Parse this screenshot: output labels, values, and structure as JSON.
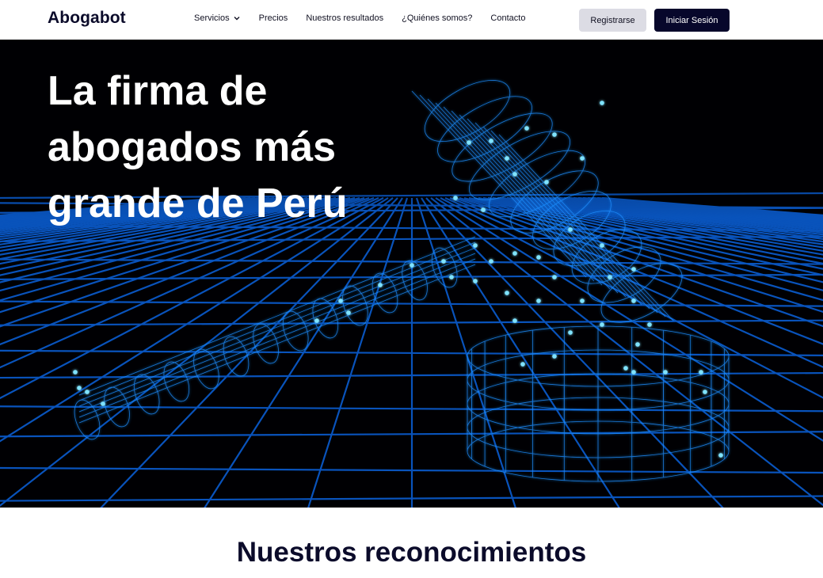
{
  "header": {
    "logo": "Abogabot",
    "nav": [
      {
        "label": "Servicios",
        "has_dropdown": true,
        "icon": "chevron-down-icon"
      },
      {
        "label": "Precios"
      },
      {
        "label": "Nuestros resultados"
      },
      {
        "label": "¿Quiénes somos?"
      },
      {
        "label": "Contacto"
      }
    ],
    "register_label": "Registrarse",
    "login_label": "Iniciar Sesión"
  },
  "hero": {
    "title_line1": "La firma de",
    "title_line2": "abogados más",
    "title_line3": "grande de Perú",
    "image": "wireframe-gavel-illustration"
  },
  "section": {
    "title": "Nuestros reconocimientos"
  },
  "colors": {
    "brand_dark": "#07072b",
    "glow_blue": "#1e8fff",
    "grid_blue": "#0a5ccf",
    "button_light": "#dcdce4"
  }
}
